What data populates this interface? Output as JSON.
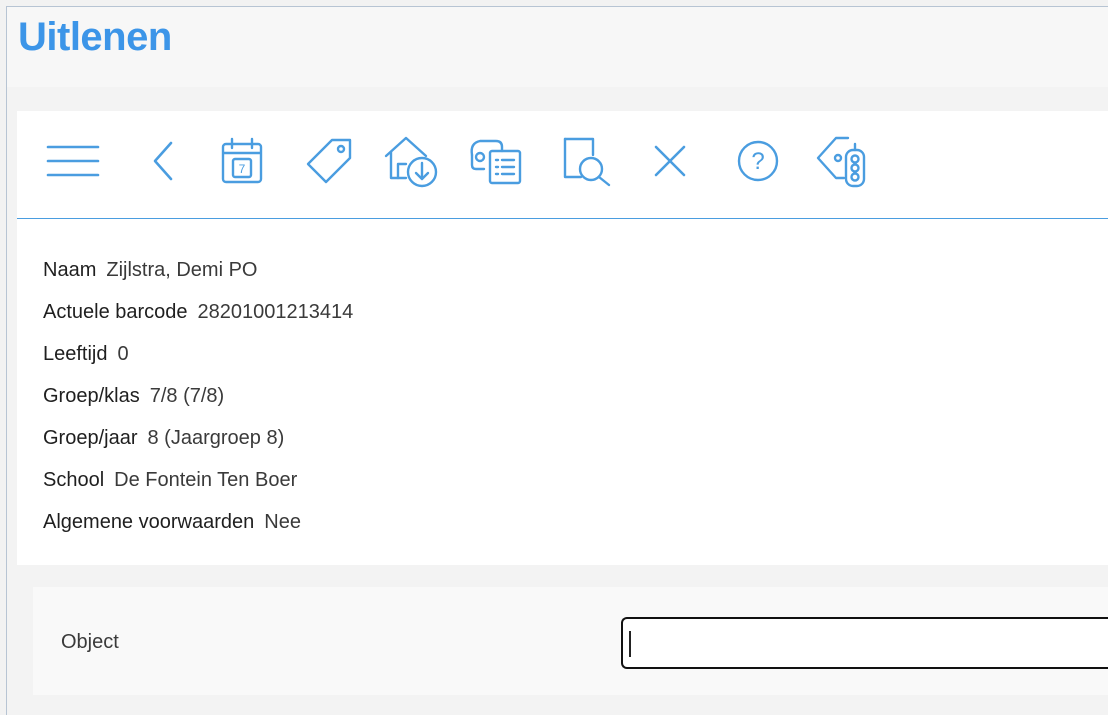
{
  "header": {
    "title": "Uitlenen"
  },
  "toolbar": {
    "icons": [
      "menu-icon",
      "back-icon",
      "calendar-icon",
      "tag-icon",
      "home-return-icon",
      "reservations-icon",
      "search-document-icon",
      "close-icon",
      "help-icon",
      "tag-traffic-light-icon"
    ],
    "calendar_day": "7",
    "help_glyph": "?"
  },
  "patron": {
    "rows": [
      {
        "label": "Naam",
        "value": "Zijlstra, Demi PO"
      },
      {
        "label": "Actuele barcode",
        "value": "28201001213414"
      },
      {
        "label": "Leeftijd",
        "value": "0"
      },
      {
        "label": "Groep/klas",
        "value": "7/8 (7/8)"
      },
      {
        "label": "Groep/jaar",
        "value": "8 (Jaargroep 8)"
      },
      {
        "label": "School",
        "value": "De Fontein Ten Boer"
      },
      {
        "label": "Algemene voorwaarden",
        "value": "Nee"
      }
    ]
  },
  "object_field": {
    "label": "Object",
    "value": ""
  },
  "colors": {
    "accent": "#3c95e8",
    "icon": "#4a9de0"
  }
}
